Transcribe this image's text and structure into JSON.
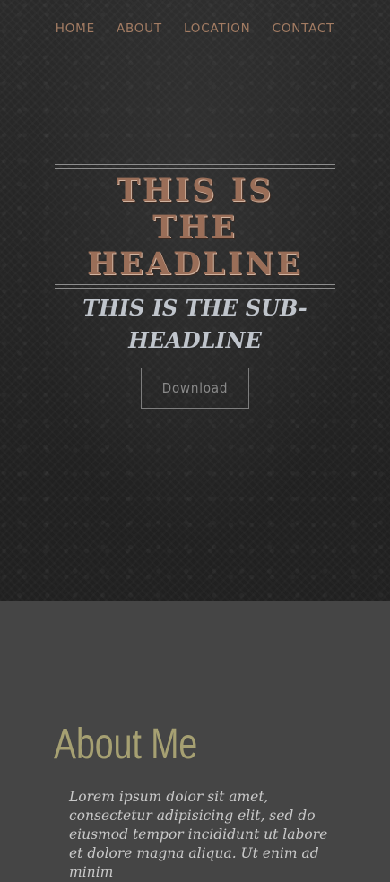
{
  "nav": {
    "items": [
      {
        "label": "HOME"
      },
      {
        "label": "ABOUT"
      },
      {
        "label": "LOCATION"
      },
      {
        "label": "CONTACT"
      }
    ]
  },
  "hero": {
    "headline_lines": [
      "THIS IS",
      "THE",
      "HEADLINE"
    ],
    "subheadline_lines": [
      "THIS IS THE SUB-",
      "HEADLINE"
    ],
    "download_label": "Download"
  },
  "about": {
    "title": "About Me",
    "text": "Lorem ipsum dolor sit amet, consectetur adipisicing elit, sed do eiusmod tempor incididunt ut labore et dolore magna aliqua. Ut enim ad minim"
  },
  "colors": {
    "nav_text": "#a37c63",
    "headline": "#9a6e58",
    "subheadline": "#c0c5cc",
    "about_title": "#a6a072",
    "hero_background": "#2a2a2a",
    "about_background": "#454545"
  }
}
